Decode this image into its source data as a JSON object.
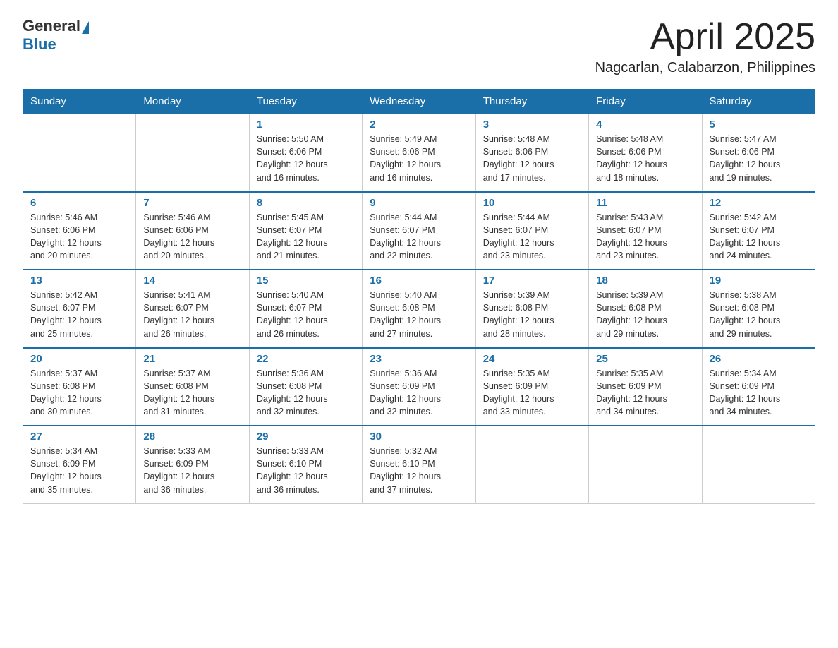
{
  "logo": {
    "general": "General",
    "blue": "Blue"
  },
  "title": {
    "month_year": "April 2025",
    "location": "Nagcarlan, Calabarzon, Philippines"
  },
  "weekdays": [
    "Sunday",
    "Monday",
    "Tuesday",
    "Wednesday",
    "Thursday",
    "Friday",
    "Saturday"
  ],
  "weeks": [
    [
      {
        "day": "",
        "info": ""
      },
      {
        "day": "",
        "info": ""
      },
      {
        "day": "1",
        "info": "Sunrise: 5:50 AM\nSunset: 6:06 PM\nDaylight: 12 hours\nand 16 minutes."
      },
      {
        "day": "2",
        "info": "Sunrise: 5:49 AM\nSunset: 6:06 PM\nDaylight: 12 hours\nand 16 minutes."
      },
      {
        "day": "3",
        "info": "Sunrise: 5:48 AM\nSunset: 6:06 PM\nDaylight: 12 hours\nand 17 minutes."
      },
      {
        "day": "4",
        "info": "Sunrise: 5:48 AM\nSunset: 6:06 PM\nDaylight: 12 hours\nand 18 minutes."
      },
      {
        "day": "5",
        "info": "Sunrise: 5:47 AM\nSunset: 6:06 PM\nDaylight: 12 hours\nand 19 minutes."
      }
    ],
    [
      {
        "day": "6",
        "info": "Sunrise: 5:46 AM\nSunset: 6:06 PM\nDaylight: 12 hours\nand 20 minutes."
      },
      {
        "day": "7",
        "info": "Sunrise: 5:46 AM\nSunset: 6:06 PM\nDaylight: 12 hours\nand 20 minutes."
      },
      {
        "day": "8",
        "info": "Sunrise: 5:45 AM\nSunset: 6:07 PM\nDaylight: 12 hours\nand 21 minutes."
      },
      {
        "day": "9",
        "info": "Sunrise: 5:44 AM\nSunset: 6:07 PM\nDaylight: 12 hours\nand 22 minutes."
      },
      {
        "day": "10",
        "info": "Sunrise: 5:44 AM\nSunset: 6:07 PM\nDaylight: 12 hours\nand 23 minutes."
      },
      {
        "day": "11",
        "info": "Sunrise: 5:43 AM\nSunset: 6:07 PM\nDaylight: 12 hours\nand 23 minutes."
      },
      {
        "day": "12",
        "info": "Sunrise: 5:42 AM\nSunset: 6:07 PM\nDaylight: 12 hours\nand 24 minutes."
      }
    ],
    [
      {
        "day": "13",
        "info": "Sunrise: 5:42 AM\nSunset: 6:07 PM\nDaylight: 12 hours\nand 25 minutes."
      },
      {
        "day": "14",
        "info": "Sunrise: 5:41 AM\nSunset: 6:07 PM\nDaylight: 12 hours\nand 26 minutes."
      },
      {
        "day": "15",
        "info": "Sunrise: 5:40 AM\nSunset: 6:07 PM\nDaylight: 12 hours\nand 26 minutes."
      },
      {
        "day": "16",
        "info": "Sunrise: 5:40 AM\nSunset: 6:08 PM\nDaylight: 12 hours\nand 27 minutes."
      },
      {
        "day": "17",
        "info": "Sunrise: 5:39 AM\nSunset: 6:08 PM\nDaylight: 12 hours\nand 28 minutes."
      },
      {
        "day": "18",
        "info": "Sunrise: 5:39 AM\nSunset: 6:08 PM\nDaylight: 12 hours\nand 29 minutes."
      },
      {
        "day": "19",
        "info": "Sunrise: 5:38 AM\nSunset: 6:08 PM\nDaylight: 12 hours\nand 29 minutes."
      }
    ],
    [
      {
        "day": "20",
        "info": "Sunrise: 5:37 AM\nSunset: 6:08 PM\nDaylight: 12 hours\nand 30 minutes."
      },
      {
        "day": "21",
        "info": "Sunrise: 5:37 AM\nSunset: 6:08 PM\nDaylight: 12 hours\nand 31 minutes."
      },
      {
        "day": "22",
        "info": "Sunrise: 5:36 AM\nSunset: 6:08 PM\nDaylight: 12 hours\nand 32 minutes."
      },
      {
        "day": "23",
        "info": "Sunrise: 5:36 AM\nSunset: 6:09 PM\nDaylight: 12 hours\nand 32 minutes."
      },
      {
        "day": "24",
        "info": "Sunrise: 5:35 AM\nSunset: 6:09 PM\nDaylight: 12 hours\nand 33 minutes."
      },
      {
        "day": "25",
        "info": "Sunrise: 5:35 AM\nSunset: 6:09 PM\nDaylight: 12 hours\nand 34 minutes."
      },
      {
        "day": "26",
        "info": "Sunrise: 5:34 AM\nSunset: 6:09 PM\nDaylight: 12 hours\nand 34 minutes."
      }
    ],
    [
      {
        "day": "27",
        "info": "Sunrise: 5:34 AM\nSunset: 6:09 PM\nDaylight: 12 hours\nand 35 minutes."
      },
      {
        "day": "28",
        "info": "Sunrise: 5:33 AM\nSunset: 6:09 PM\nDaylight: 12 hours\nand 36 minutes."
      },
      {
        "day": "29",
        "info": "Sunrise: 5:33 AM\nSunset: 6:10 PM\nDaylight: 12 hours\nand 36 minutes."
      },
      {
        "day": "30",
        "info": "Sunrise: 5:32 AM\nSunset: 6:10 PM\nDaylight: 12 hours\nand 37 minutes."
      },
      {
        "day": "",
        "info": ""
      },
      {
        "day": "",
        "info": ""
      },
      {
        "day": "",
        "info": ""
      }
    ]
  ]
}
